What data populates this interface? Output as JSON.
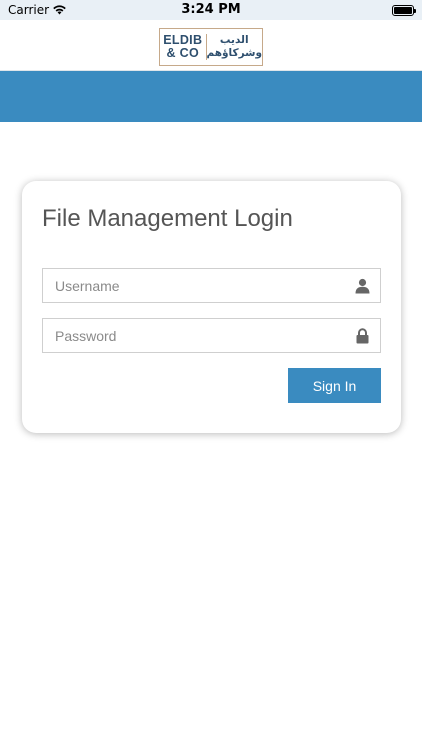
{
  "status_bar": {
    "carrier": "Carrier",
    "time": "3:24 PM",
    "icons": [
      "wifi-icon",
      "battery-icon"
    ]
  },
  "header": {
    "logo": {
      "english_line1": "ELDIB",
      "english_line2": "& CO",
      "arabic_line1": "الديب",
      "arabic_line2": "وشركاؤهم"
    }
  },
  "colors": {
    "accent": "#3a8bc0",
    "title_text": "#555555",
    "logo_text": "#2e4f6e",
    "logo_border": "#c6a98a"
  },
  "login": {
    "title": "File Management Login",
    "username": {
      "value": "",
      "placeholder": "Username",
      "icon": "user-icon"
    },
    "password": {
      "value": "",
      "placeholder": "Password",
      "icon": "lock-icon"
    },
    "signin_label": "Sign In"
  }
}
